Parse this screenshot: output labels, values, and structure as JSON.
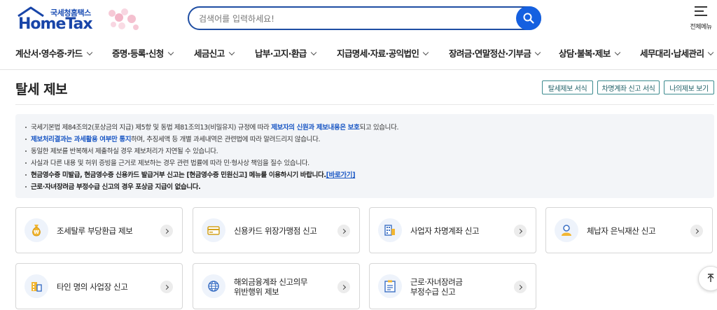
{
  "header": {
    "logo_sub": "국세청홈택스",
    "logo_main": "HomeTax",
    "search_placeholder": "검색어를 입력하세요!",
    "all_menu_label": "전체메뉴"
  },
  "gnb": [
    {
      "label": "계산서·영수증·카드"
    },
    {
      "label": "증명·등록·신청"
    },
    {
      "label": "세금신고"
    },
    {
      "label": "납부·고지·환급"
    },
    {
      "label": "지급명세·자료·공익법인"
    },
    {
      "label": "장려금·연말정산·기부금"
    },
    {
      "label": "상담·불복·제보"
    },
    {
      "label": "세무대리·납세관리"
    }
  ],
  "page": {
    "title": "탈세 제보",
    "buttons": [
      "탈세제보 서식",
      "차명계좌 신고 서식",
      "나의제보 보기"
    ]
  },
  "notice": {
    "l1_a": "국세기본법 제84조의2(포상금의 지급) 제5항 및 동법 제81조의13(비밀유지) 규정에 따라 ",
    "l1_b": "제보자의 신원과 제보내용은 보호",
    "l1_c": "되고 있습니다.",
    "l2_a": "제보처리결과는 과세활용 여부만 통지",
    "l2_b": "하며, 추징세액 등 개별 과세내역은 관련법에 따라 알려드리지 않습니다.",
    "l3": "동일한 제보를 반복해서 제출하실 경우 제보처리가 지연될 수 있습니다.",
    "l4": "사실과 다른 내용 및 허위 증빙을 근거로 제보하는 경우 관련 법률에 따라 민·형사상 책임을 질수 있습니다.",
    "l5_a": "현금영수증 미발급, 현금영수증 신용카드 발급거부 신고는 [현금영수증 민원신고] 메뉴를 이용하시기 바랍니다.",
    "l5_link": "[바로가기]",
    "l6": "근로·자녀장려금 부정수급 신고의 경우 포상금 지급이 없습니다."
  },
  "cards": [
    {
      "label": "조세탈루 부당환급 제보",
      "icon": "money-bag-icon"
    },
    {
      "label": "신용카드 위장가맹점 신고",
      "icon": "credit-card-icon"
    },
    {
      "label": "사업자 차명계좌 신고",
      "icon": "building-icon"
    },
    {
      "label": "체납자 은닉재산 신고",
      "icon": "person-icon"
    },
    {
      "label": "타인 명의 사업장 신고",
      "icon": "office-icon"
    },
    {
      "label_1": "해외금융계좌 신고의무",
      "label_2": "위반행위 제보",
      "icon": "globe-icon"
    },
    {
      "label_1": "근로·자녀장려금",
      "label_2": "부정수급 신고",
      "icon": "document-icon"
    }
  ],
  "colors": {
    "brand": "#1845a8",
    "search_btn": "#1560e0",
    "notice_bg": "#f3f5f8",
    "accent_teal": "#3b8a8e"
  }
}
